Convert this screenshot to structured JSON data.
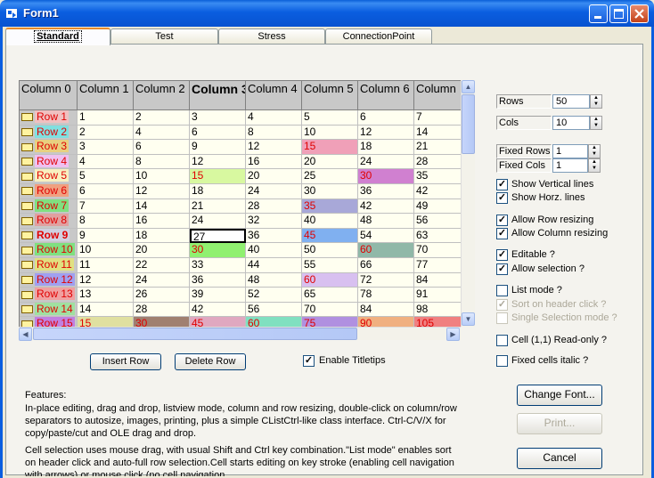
{
  "window": {
    "title": "Form1"
  },
  "tabs": [
    {
      "label": "Standard",
      "active": true
    },
    {
      "label": "Test",
      "active": false
    },
    {
      "label": "Stress",
      "active": false
    },
    {
      "label": "ConnectionPoint",
      "active": false
    }
  ],
  "grid": {
    "columns": [
      "Column 0",
      "Column 1",
      "Column 2",
      "Column 3",
      "Column 4",
      "Column 5",
      "Column 6",
      "Column"
    ],
    "selected_column": 3,
    "rows": [
      {
        "label": "Row 1",
        "color": "#f0c0c0",
        "text": "#e00000",
        "values": [
          "1",
          "2",
          "3",
          "4",
          "5",
          "6",
          "7"
        ]
      },
      {
        "label": "Row 2",
        "color": "#80e0e0",
        "text": "#e00000",
        "values": [
          "2",
          "4",
          "6",
          "8",
          "10",
          "12",
          "14"
        ]
      },
      {
        "label": "Row 3",
        "color": "#e8d080",
        "text": "#e00000",
        "values": [
          "3",
          "6",
          "9",
          "12",
          "15",
          "18",
          "21"
        ]
      },
      {
        "label": "Row 4",
        "color": "#f0c0f0",
        "text": "#e00000",
        "values": [
          "4",
          "8",
          "12",
          "16",
          "20",
          "24",
          "28"
        ]
      },
      {
        "label": "Row 5",
        "color": "#f8f0c0",
        "text": "#e00000",
        "values": [
          "5",
          "10",
          "15",
          "20",
          "25",
          "30",
          "35"
        ]
      },
      {
        "label": "Row 6",
        "color": "#f0a080",
        "text": "#e00000",
        "values": [
          "6",
          "12",
          "18",
          "24",
          "30",
          "36",
          "42"
        ]
      },
      {
        "label": "Row 7",
        "color": "#80e080",
        "text": "#e00000",
        "values": [
          "7",
          "14",
          "21",
          "28",
          "35",
          "42",
          "49"
        ]
      },
      {
        "label": "Row 8",
        "color": "#e0a0a0",
        "text": "#e00000",
        "values": [
          "8",
          "16",
          "24",
          "32",
          "40",
          "48",
          "56"
        ]
      },
      {
        "label": "Row 9",
        "color": "#d0d0e0",
        "text": "#e00000",
        "bold": true,
        "values": [
          "9",
          "18",
          "27",
          "36",
          "45",
          "54",
          "63"
        ]
      },
      {
        "label": "Row 10",
        "color": "#80e080",
        "text": "#e00000",
        "values": [
          "10",
          "20",
          "30",
          "40",
          "50",
          "60",
          "70"
        ]
      },
      {
        "label": "Row 11",
        "color": "#e0e080",
        "text": "#e00000",
        "values": [
          "11",
          "22",
          "33",
          "44",
          "55",
          "66",
          "77"
        ]
      },
      {
        "label": "Row 12",
        "color": "#a0a0f0",
        "text": "#e00000",
        "values": [
          "12",
          "24",
          "36",
          "48",
          "60",
          "72",
          "84"
        ]
      },
      {
        "label": "Row 13",
        "color": "#f0a0a0",
        "text": "#e00000",
        "values": [
          "13",
          "26",
          "39",
          "52",
          "65",
          "78",
          "91"
        ]
      },
      {
        "label": "Row 14",
        "color": "#a0e0a0",
        "text": "#e00000",
        "values": [
          "14",
          "28",
          "42",
          "56",
          "70",
          "84",
          "98"
        ]
      },
      {
        "label": "Row 15",
        "color": "#c080e0",
        "text": "#e00000",
        "values": [
          "15",
          "30",
          "45",
          "60",
          "75",
          "90",
          "105"
        ]
      }
    ],
    "colored_cells": [
      {
        "r": 2,
        "c": 5,
        "bg": "#f0a0b8",
        "fg": "#e00000"
      },
      {
        "r": 4,
        "c": 3,
        "bg": "#d8f8a0",
        "fg": "#e00000"
      },
      {
        "r": 4,
        "c": 6,
        "bg": "#d080d0",
        "fg": "#e00000"
      },
      {
        "r": 6,
        "c": 5,
        "bg": "#a8a8d8",
        "fg": "#e00000"
      },
      {
        "r": 8,
        "c": 5,
        "bg": "#80b0f0",
        "fg": "#e00000"
      },
      {
        "r": 8,
        "c": 3,
        "bg": "#ffffff",
        "fg": "#000000",
        "focus": true
      },
      {
        "r": 9,
        "c": 3,
        "bg": "#90f070",
        "fg": "#e00000"
      },
      {
        "r": 9,
        "c": 6,
        "bg": "#90b8a8",
        "fg": "#e00000"
      },
      {
        "r": 11,
        "c": 5,
        "bg": "#d8c0f0",
        "fg": "#e00000"
      },
      {
        "r": 14,
        "c": 2,
        "bg": "#a08070",
        "fg": "#e00000"
      },
      {
        "r": 14,
        "c": 3,
        "bg": "#e0a8c0",
        "fg": "#e00000"
      },
      {
        "r": 14,
        "c": 4,
        "bg": "#80e0c0",
        "fg": "#e00000"
      },
      {
        "r": 14,
        "c": 5,
        "bg": "#b090e0",
        "fg": "#e00000"
      },
      {
        "r": 14,
        "c": 6,
        "bg": "#f0b080",
        "fg": "#e00000"
      },
      {
        "r": 14,
        "c": 7,
        "bg": "#f08080",
        "fg": "#e00000"
      },
      {
        "r": 14,
        "c": 1,
        "bg": "#e0e0a0",
        "fg": "#e00000"
      }
    ]
  },
  "buttons": {
    "insert_row": "Insert Row",
    "delete_row": "Delete Row",
    "change_font": "Change Font...",
    "print": "Print...",
    "cancel": "Cancel"
  },
  "enable_titletips": {
    "label": "Enable Titletips",
    "checked": true
  },
  "settings": {
    "rows_label": "Rows",
    "rows_value": "50",
    "cols_label": "Cols",
    "cols_value": "10",
    "fixed_rows_label": "Fixed Rows",
    "fixed_rows_value": "1",
    "fixed_cols_label": "Fixed Cols",
    "fixed_cols_value": "1"
  },
  "checkboxes": [
    {
      "label": "Show Vertical lines",
      "checked": true,
      "enabled": true
    },
    {
      "label": "Show Horz. lines",
      "checked": true,
      "enabled": true
    },
    {
      "label": "Allow Row resizing",
      "checked": true,
      "enabled": true
    },
    {
      "label": "Allow Column resizing",
      "checked": true,
      "enabled": true
    },
    {
      "label": "Editable ?",
      "checked": true,
      "enabled": true
    },
    {
      "label": "Allow selection ?",
      "checked": true,
      "enabled": true
    },
    {
      "label": "List mode ?",
      "checked": false,
      "enabled": true
    },
    {
      "label": "Sort on header click ?",
      "checked": true,
      "enabled": false
    },
    {
      "label": "Single Selection mode ?",
      "checked": false,
      "enabled": false
    },
    {
      "label": "Cell (1,1) Read-only ?",
      "checked": false,
      "enabled": true
    },
    {
      "label": "Fixed cells italic ?",
      "checked": false,
      "enabled": true
    }
  ],
  "features": {
    "heading": "Features:",
    "para1": "In-place editing, drag and drop, listview mode, column and row resizing, double-click on column/row separators to autosize, images,  printing, plus a simple CListCtrl-like class interface. Ctrl-C/V/X for copy/paste/cut and OLE drag and drop.",
    "para2": "Cell selection uses mouse drag, with usual Shift and Ctrl key combination.\"List mode\" enables sort on header click and auto-full row selection.Cell starts editing on key stroke (enabling cell navigation with arrows) or mouse click (no cell navigation."
  }
}
